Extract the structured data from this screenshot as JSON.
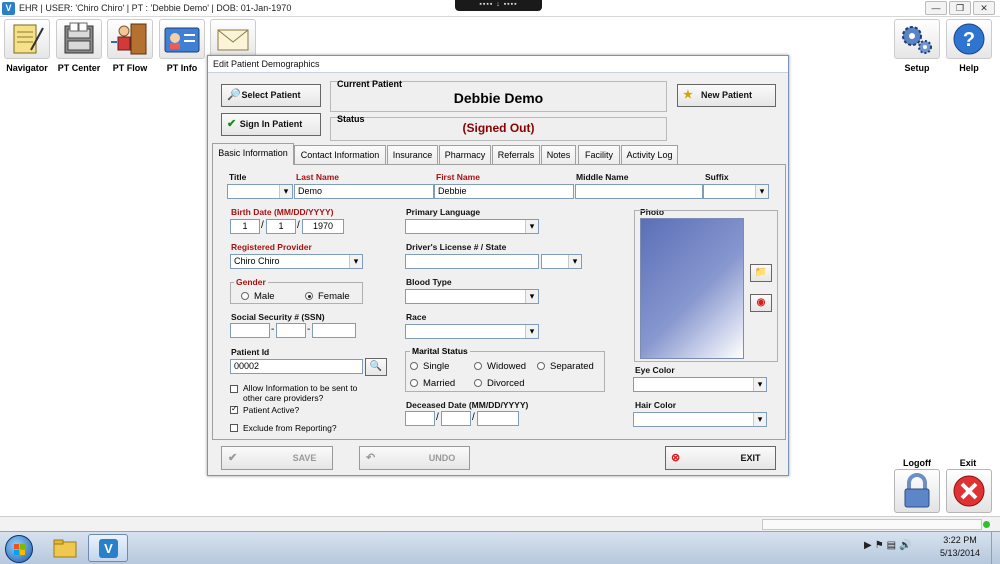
{
  "window": {
    "title": "EHR | USER: 'Chiro Chiro'  | PT : 'Debbie Demo' | DOB: 01-Jan-1970",
    "remote_bar": "▪▪▪▪ ↓ ▪▪▪▪",
    "minimize": "—",
    "restore": "❐",
    "close": "✕"
  },
  "toolbar": {
    "navigator": "Navigator",
    "pt_center": "PT Center",
    "pt_flow": "PT Flow",
    "pt_info": "PT Info",
    "setup": "Setup",
    "help": "Help"
  },
  "dialog": {
    "title": "Edit Patient Demographics",
    "select_patient": "Select Patient",
    "sign_in_patient": "Sign In Patient",
    "new_patient": "New Patient",
    "current_patient_label": "Current Patient",
    "current_patient": "Debbie Demo",
    "status_label": "Status",
    "status": "(Signed Out)",
    "status_color": "#8b0000",
    "save": "SAVE",
    "undo": "UNDO",
    "exit": "EXIT"
  },
  "tabs": [
    "Basic Information",
    "Contact Information",
    "Insurance",
    "Pharmacy",
    "Referrals",
    "Notes",
    "Facility",
    "Activity Log"
  ],
  "form": {
    "title_label": "Title",
    "title_value": "",
    "last_name_label": "Last Name",
    "last_name": "Demo",
    "first_name_label": "First Name",
    "first_name": "Debbie",
    "middle_name_label": "Middle Name",
    "middle_name": "",
    "suffix_label": "Suffix",
    "suffix": "",
    "birth_date_label": "Birth Date (MM/DD/YYYY)",
    "birth_month": "1",
    "birth_day": "1",
    "birth_year": "1970",
    "primary_language_label": "Primary Language",
    "primary_language": "",
    "photo_label": "Photo",
    "registered_provider_label": "Registered Provider",
    "registered_provider": "Chiro Chiro",
    "drivers_license_label": "Driver's License # / State",
    "gender_label": "Gender",
    "gender_male": "Male",
    "gender_female": "Female",
    "gender_selected": "Female",
    "blood_type_label": "Blood Type",
    "ssn_label": "Social Security # (SSN)",
    "race_label": "Race",
    "patient_id_label": "Patient Id",
    "patient_id": "00002",
    "marital_status_label": "Marital Status",
    "marital_single": "Single",
    "marital_widowed": "Widowed",
    "marital_separated": "Separated",
    "marital_married": "Married",
    "marital_divorced": "Divorced",
    "eye_color_label": "Eye Color",
    "hair_color_label": "Hair Color",
    "allow_info_label": "Allow Information to be sent to other care providers?",
    "allow_info_checked": false,
    "patient_active_label": "Patient Active?",
    "patient_active_checked": true,
    "exclude_reporting_label": "Exclude from Reporting?",
    "exclude_reporting_checked": false,
    "deceased_date_label": "Deceased Date (MM/DD/YYYY)"
  },
  "bottom": {
    "logoff": "Logoff",
    "exit": "Exit"
  },
  "taskbar": {
    "time": "3:22 PM",
    "date": "5/13/2014"
  }
}
